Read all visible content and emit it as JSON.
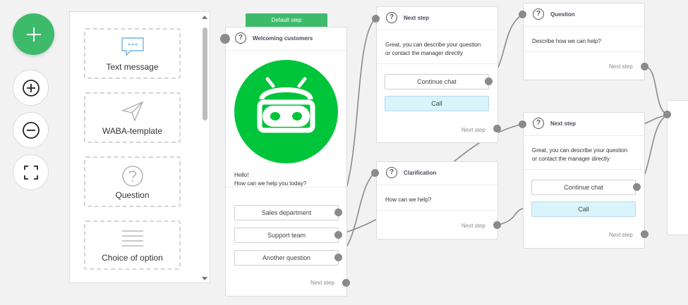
{
  "palette": {
    "items": [
      {
        "label": "Text message",
        "icon": "chat-bubble-icon"
      },
      {
        "label": "WABA-template",
        "icon": "send-icon"
      },
      {
        "label": "Question",
        "icon": "question-icon"
      },
      {
        "label": "Choice of option",
        "icon": "list-icon"
      }
    ]
  },
  "colors": {
    "accent": "#3dbb6b",
    "bot": "#00c43a",
    "call": "#d9f4fb"
  },
  "default_tag": "Default step",
  "welcome": {
    "title": "Welcoming customers",
    "message_line1": "Hello!",
    "message_line2": "How can we help you today?",
    "buttons": [
      "Sales department",
      "Support team",
      "Another question"
    ],
    "next": "Next step"
  },
  "next1": {
    "title": "Next step",
    "text_line1": "Great, you can describe your question",
    "text_line2": "or contact the manager directly",
    "btn_chat": "Continue chat",
    "btn_call": "Call",
    "next": "Next step"
  },
  "clarification": {
    "title": "Clarification",
    "text": "How can we help?",
    "next": "Next step"
  },
  "question": {
    "title": "Question",
    "text": "Describe how we can help?",
    "next": "Next step"
  },
  "next2": {
    "title": "Next step",
    "text_line1": "Great, you can describe your question",
    "text_line2": "or contact the manager directly",
    "btn_chat": "Continue chat",
    "btn_call": "Call",
    "next": "Next step"
  },
  "question_mark": "?"
}
